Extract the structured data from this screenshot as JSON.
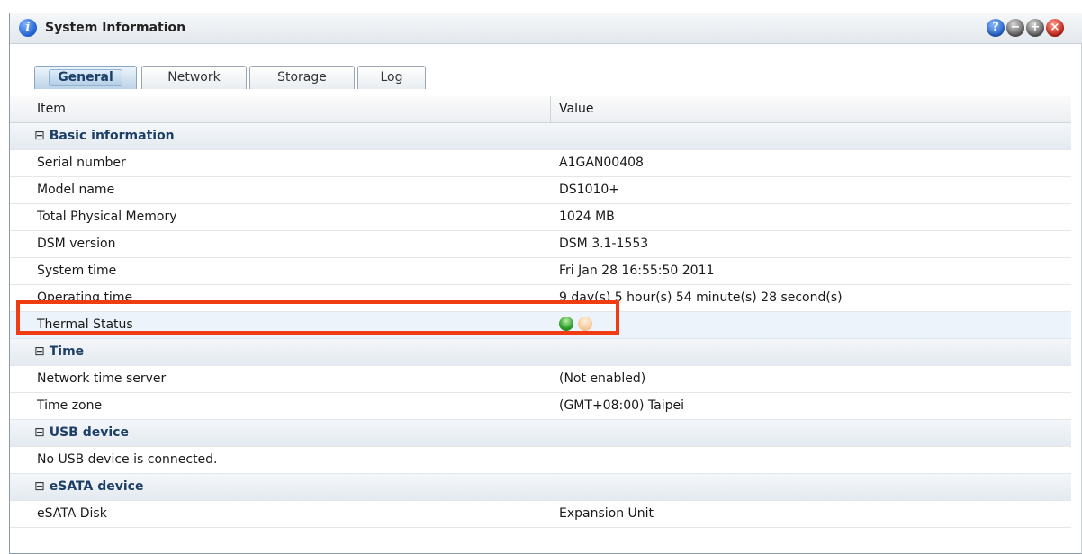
{
  "window": {
    "title": "System Information"
  },
  "tabs": [
    {
      "label": "General",
      "active": true
    },
    {
      "label": "Network",
      "active": false
    },
    {
      "label": "Storage",
      "active": false
    },
    {
      "label": "Log",
      "active": false
    }
  ],
  "table": {
    "columns": [
      "Item",
      "Value"
    ],
    "sections": [
      {
        "name": "Basic information",
        "rows": [
          {
            "item": "Serial number",
            "value": "A1GAN00408"
          },
          {
            "item": "Model name",
            "value": "DS1010+"
          },
          {
            "item": "Total Physical Memory",
            "value": "1024 MB"
          },
          {
            "item": "DSM version",
            "value": "DSM 3.1-1553"
          },
          {
            "item": "System time",
            "value": "Fri Jan 28 16:55:50 2011"
          },
          {
            "item": "Operating time",
            "value": "9 day(s) 5 hour(s) 54 minute(s) 28 second(s)"
          },
          {
            "item": "Thermal Status",
            "value": ""
          }
        ]
      },
      {
        "name": "Time",
        "rows": [
          {
            "item": "Network time server",
            "value": "(Not enabled)"
          },
          {
            "item": "Time zone",
            "value": "(GMT+08:00) Taipei"
          }
        ]
      },
      {
        "name": "USB device",
        "rows": [
          {
            "item": "No USB device is connected.",
            "value": ""
          }
        ]
      },
      {
        "name": "eSATA device",
        "rows": [
          {
            "item": "eSATA Disk",
            "value": "Expansion Unit"
          }
        ]
      }
    ]
  },
  "thermal_status_icons": [
    "green-status-light-icon",
    "orange-status-light-icon"
  ],
  "colors": {
    "highlight": "#f03c12",
    "section_text": "#1d3f66"
  },
  "icons": {
    "title": "info-icon",
    "help": "help-icon",
    "minimize": "minimize-icon",
    "maximize": "maximize-icon",
    "close": "close-icon",
    "collapse": "collapse-icon"
  }
}
